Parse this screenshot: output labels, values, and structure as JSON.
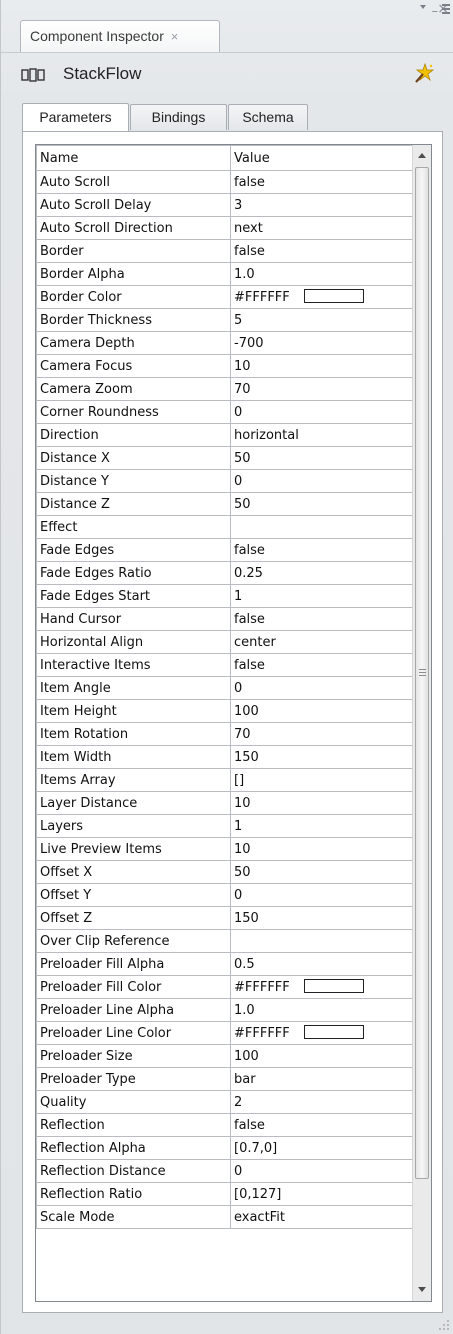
{
  "window": {
    "tab_title": "Component Inspector",
    "tab_close_glyph": "×",
    "minimize_glyph": "–",
    "close_glyph": "×"
  },
  "component": {
    "name": "StackFlow",
    "icon": "component-icon",
    "action_icon": "wizard-icon"
  },
  "tabs": [
    {
      "label": "Parameters",
      "selected": true
    },
    {
      "label": "Bindings",
      "selected": false
    },
    {
      "label": "Schema",
      "selected": false
    }
  ],
  "grid": {
    "headers": {
      "name": "Name",
      "value": "Value"
    },
    "rows": [
      {
        "name": "Auto Scroll",
        "value": "false"
      },
      {
        "name": "Auto Scroll Delay",
        "value": "3"
      },
      {
        "name": "Auto Scroll Direction",
        "value": "next"
      },
      {
        "name": "Border",
        "value": "false"
      },
      {
        "name": "Border Alpha",
        "value": "1.0"
      },
      {
        "name": "Border Color",
        "value": "#FFFFFF",
        "swatch": "#FFFFFF"
      },
      {
        "name": "Border Thickness",
        "value": "5"
      },
      {
        "name": "Camera Depth",
        "value": "-700"
      },
      {
        "name": "Camera Focus",
        "value": "10"
      },
      {
        "name": "Camera Zoom",
        "value": "70"
      },
      {
        "name": "Corner Roundness",
        "value": "0"
      },
      {
        "name": "Direction",
        "value": "horizontal"
      },
      {
        "name": "Distance X",
        "value": "50"
      },
      {
        "name": "Distance Y",
        "value": "0"
      },
      {
        "name": "Distance Z",
        "value": "50"
      },
      {
        "name": "Effect",
        "value": ""
      },
      {
        "name": "Fade Edges",
        "value": "false"
      },
      {
        "name": "Fade Edges Ratio",
        "value": "0.25"
      },
      {
        "name": "Fade Edges Start",
        "value": "1"
      },
      {
        "name": "Hand Cursor",
        "value": "false"
      },
      {
        "name": "Horizontal Align",
        "value": "center"
      },
      {
        "name": "Interactive Items",
        "value": "false"
      },
      {
        "name": "Item Angle",
        "value": "0"
      },
      {
        "name": "Item Height",
        "value": "100"
      },
      {
        "name": "Item Rotation",
        "value": "70"
      },
      {
        "name": "Item Width",
        "value": "150"
      },
      {
        "name": "Items Array",
        "value": "[]"
      },
      {
        "name": "Layer Distance",
        "value": "10"
      },
      {
        "name": "Layers",
        "value": "1"
      },
      {
        "name": "Live Preview Items",
        "value": "10"
      },
      {
        "name": "Offset X",
        "value": "50"
      },
      {
        "name": "Offset Y",
        "value": "0"
      },
      {
        "name": "Offset Z",
        "value": "150"
      },
      {
        "name": "Over Clip Reference",
        "value": ""
      },
      {
        "name": "Preloader Fill Alpha",
        "value": "0.5"
      },
      {
        "name": "Preloader Fill Color",
        "value": "#FFFFFF",
        "swatch": "#FFFFFF"
      },
      {
        "name": "Preloader Line Alpha",
        "value": "1.0"
      },
      {
        "name": "Preloader Line Color",
        "value": "#FFFFFF",
        "swatch": "#FFFFFF"
      },
      {
        "name": "Preloader Size",
        "value": "100"
      },
      {
        "name": "Preloader Type",
        "value": "bar"
      },
      {
        "name": "Quality",
        "value": "2"
      },
      {
        "name": "Reflection",
        "value": "false"
      },
      {
        "name": "Reflection Alpha",
        "value": "[0.7,0]"
      },
      {
        "name": "Reflection Distance",
        "value": "0"
      },
      {
        "name": "Reflection Ratio",
        "value": "[0,127]"
      },
      {
        "name": "Scale Mode",
        "value": "exactFit"
      }
    ]
  },
  "colors": {
    "panel_bg": "#e4e7ea",
    "grid_border": "#b9bdc2",
    "frame_border": "#a9aeb4"
  }
}
